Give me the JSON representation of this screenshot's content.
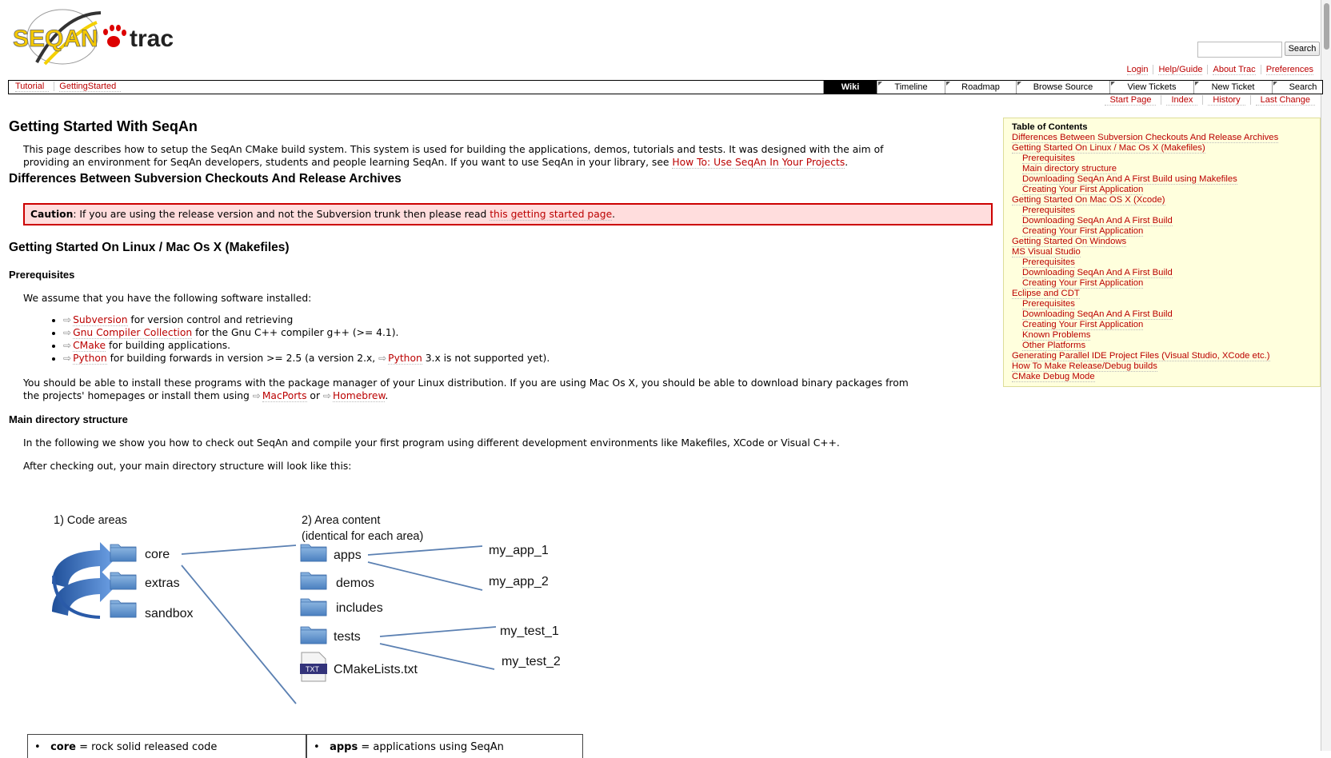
{
  "header": {
    "logo_text_1": "SEQAN",
    "logo_text_2": "trac",
    "search_button": "Search",
    "metanav": [
      "Login",
      "Help/Guide",
      "About Trac",
      "Preferences"
    ]
  },
  "ctxnav": {
    "breadcrumbs": [
      "Tutorial",
      "GettingStarted"
    ],
    "tabs": [
      {
        "label": "Wiki",
        "active": true,
        "w": 66
      },
      {
        "label": "Timeline",
        "active": false,
        "w": 84
      },
      {
        "label": "Roadmap",
        "active": false,
        "w": 88
      },
      {
        "label": "Browse Source",
        "active": false,
        "w": 116
      },
      {
        "label": "View Tickets",
        "active": false,
        "w": 104
      },
      {
        "label": "New Ticket",
        "active": false,
        "w": 97
      },
      {
        "label": "Search",
        "active": false,
        "w": 76
      }
    ]
  },
  "pagenav": [
    "Start Page",
    "Index",
    "History",
    "Last Change"
  ],
  "content": {
    "title": "Getting Started With SeqAn",
    "intro_1": "This page describes how to setup the SeqAn CMake build system. This system is used for building the applications, demos, tutorials and tests. It was designed with the aim of",
    "intro_2": "providing an environment for SeqAn developers, students and people learning SeqAn. If you want to use SeqAn in your library, see ",
    "intro_link": "How To: Use SeqAn In Your Projects",
    "intro_end": ".",
    "h_diff": "Differences Between Subversion Checkouts And Release Archives",
    "caution_label": "Caution",
    "caution_text": ": If you are using the release version and not the Subversion trunk then please read ",
    "caution_link": "this getting started page",
    "caution_end": ".",
    "h_linux": "Getting Started On Linux / Mac Os X (Makefiles)",
    "h_prereq": "Prerequisites",
    "assume": "We assume that you have the following software installed:",
    "software": [
      {
        "link": "Subversion",
        "text": " for version control and retrieving"
      },
      {
        "link": "Gnu Compiler Collection",
        "text": " for the Gnu C++ compiler g++ (>= 4.1)."
      },
      {
        "link": "CMake",
        "text": " for building applications."
      },
      {
        "link": "Python",
        "text": " for building forwards in version >= 2.5 (a version 2.x, ",
        "link2": "Python",
        "text2": " 3.x is not supported yet)."
      }
    ],
    "install_1": "You should be able to install these programs with the package manager of your Linux distribution. If you are using Mac Os X, you should be able to download binary packages from",
    "install_2": "the projects' homepages or install them using ",
    "macports": "MacPorts",
    "or": " or ",
    "homebrew": "Homebrew",
    "install_end": ".",
    "h_main": "Main directory structure",
    "following": "In the following we show you how to check out SeqAn and compile your first program using different development environments like Makefiles, XCode or Visual C++.",
    "after": "After checking out, your main directory structure will look like this:"
  },
  "toc": {
    "title": "Table of Contents",
    "entries": [
      {
        "t": "Differences Between Subversion Checkouts And Release Archives",
        "sub": false
      },
      {
        "t": "Getting Started On Linux / Mac Os X (Makefiles)",
        "sub": false
      },
      {
        "t": "Prerequisites",
        "sub": true
      },
      {
        "t": "Main directory structure",
        "sub": true
      },
      {
        "t": "Downloading SeqAn And A First Build using Makefiles",
        "sub": true
      },
      {
        "t": "Creating Your First Application",
        "sub": true
      },
      {
        "t": "Getting Started On Mac OS X (Xcode)",
        "sub": false
      },
      {
        "t": "Prerequisites",
        "sub": true
      },
      {
        "t": "Downloading SeqAn And A First Build",
        "sub": true
      },
      {
        "t": "Creating Your First Application",
        "sub": true
      },
      {
        "t": "Getting Started On Windows",
        "sub": false
      },
      {
        "t": "MS Visual Studio",
        "sub": false
      },
      {
        "t": "Prerequisites",
        "sub": true
      },
      {
        "t": "Downloading SeqAn And A First Build",
        "sub": true
      },
      {
        "t": "Creating Your First Application",
        "sub": true
      },
      {
        "t": "Eclipse and CDT",
        "sub": false
      },
      {
        "t": "Prerequisites",
        "sub": true
      },
      {
        "t": "Downloading SeqAn And A First Build",
        "sub": true
      },
      {
        "t": "Creating Your First Application",
        "sub": true
      },
      {
        "t": "Known Problems",
        "sub": true
      },
      {
        "t": "Other Platforms",
        "sub": true
      },
      {
        "t": "Generating Parallel IDE Project Files (Visual Studio, XCode etc.)",
        "sub": false
      },
      {
        "t": "How To Make Release/Debug builds",
        "sub": false
      },
      {
        "t": "CMake Debug Mode",
        "sub": false
      }
    ]
  },
  "diagram": {
    "heading_1": "1) Code areas",
    "heading_2a": "2) Area content",
    "heading_2b": "(identical for each area)",
    "areas": [
      "core",
      "extras",
      "sandbox"
    ],
    "contents": [
      "apps",
      "demos",
      "includes",
      "tests",
      "CMakeLists.txt"
    ],
    "apps_items": [
      "my_app_1",
      "my_app_2"
    ],
    "test_items": [
      "my_test_1",
      "my_test_2"
    ],
    "txt_badge": "TXT"
  },
  "legend": {
    "left_bold": "core",
    "left_text": " = rock solid released code",
    "right_bold": "apps",
    "right_text": " = applications using SeqAn"
  },
  "colors": {
    "link": "#bb0000",
    "caution_bg": "#ffdddd",
    "caution_border": "#cc0000",
    "toc_bg": "#ffffdd",
    "folder": "#5b8fc7",
    "arrow": "#3d74c4"
  }
}
